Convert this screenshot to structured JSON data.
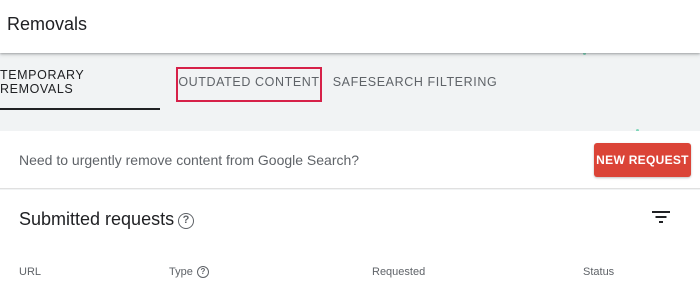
{
  "header": {
    "title": "Removals"
  },
  "tabs": [
    {
      "label": "TEMPORARY REMOVALS",
      "active": true
    },
    {
      "label": "OUTDATED CONTENT",
      "active": false,
      "highlighted": true
    },
    {
      "label": "SAFESEARCH FILTERING",
      "active": false
    }
  ],
  "request_card": {
    "prompt": "Need to urgently remove content from Google Search?",
    "button_label": "NEW REQUEST"
  },
  "submitted": {
    "title": "Submitted requests",
    "help_icon": "?",
    "columns": {
      "url": "URL",
      "type": "Type",
      "requested": "Requested",
      "status": "Status"
    }
  },
  "icons": {
    "help": "help-circle-icon",
    "filter": "filter-list-icon"
  },
  "colors": {
    "accent_button": "#db4437",
    "highlight_border": "#d62048",
    "tab_active_indicator": "#202124"
  }
}
